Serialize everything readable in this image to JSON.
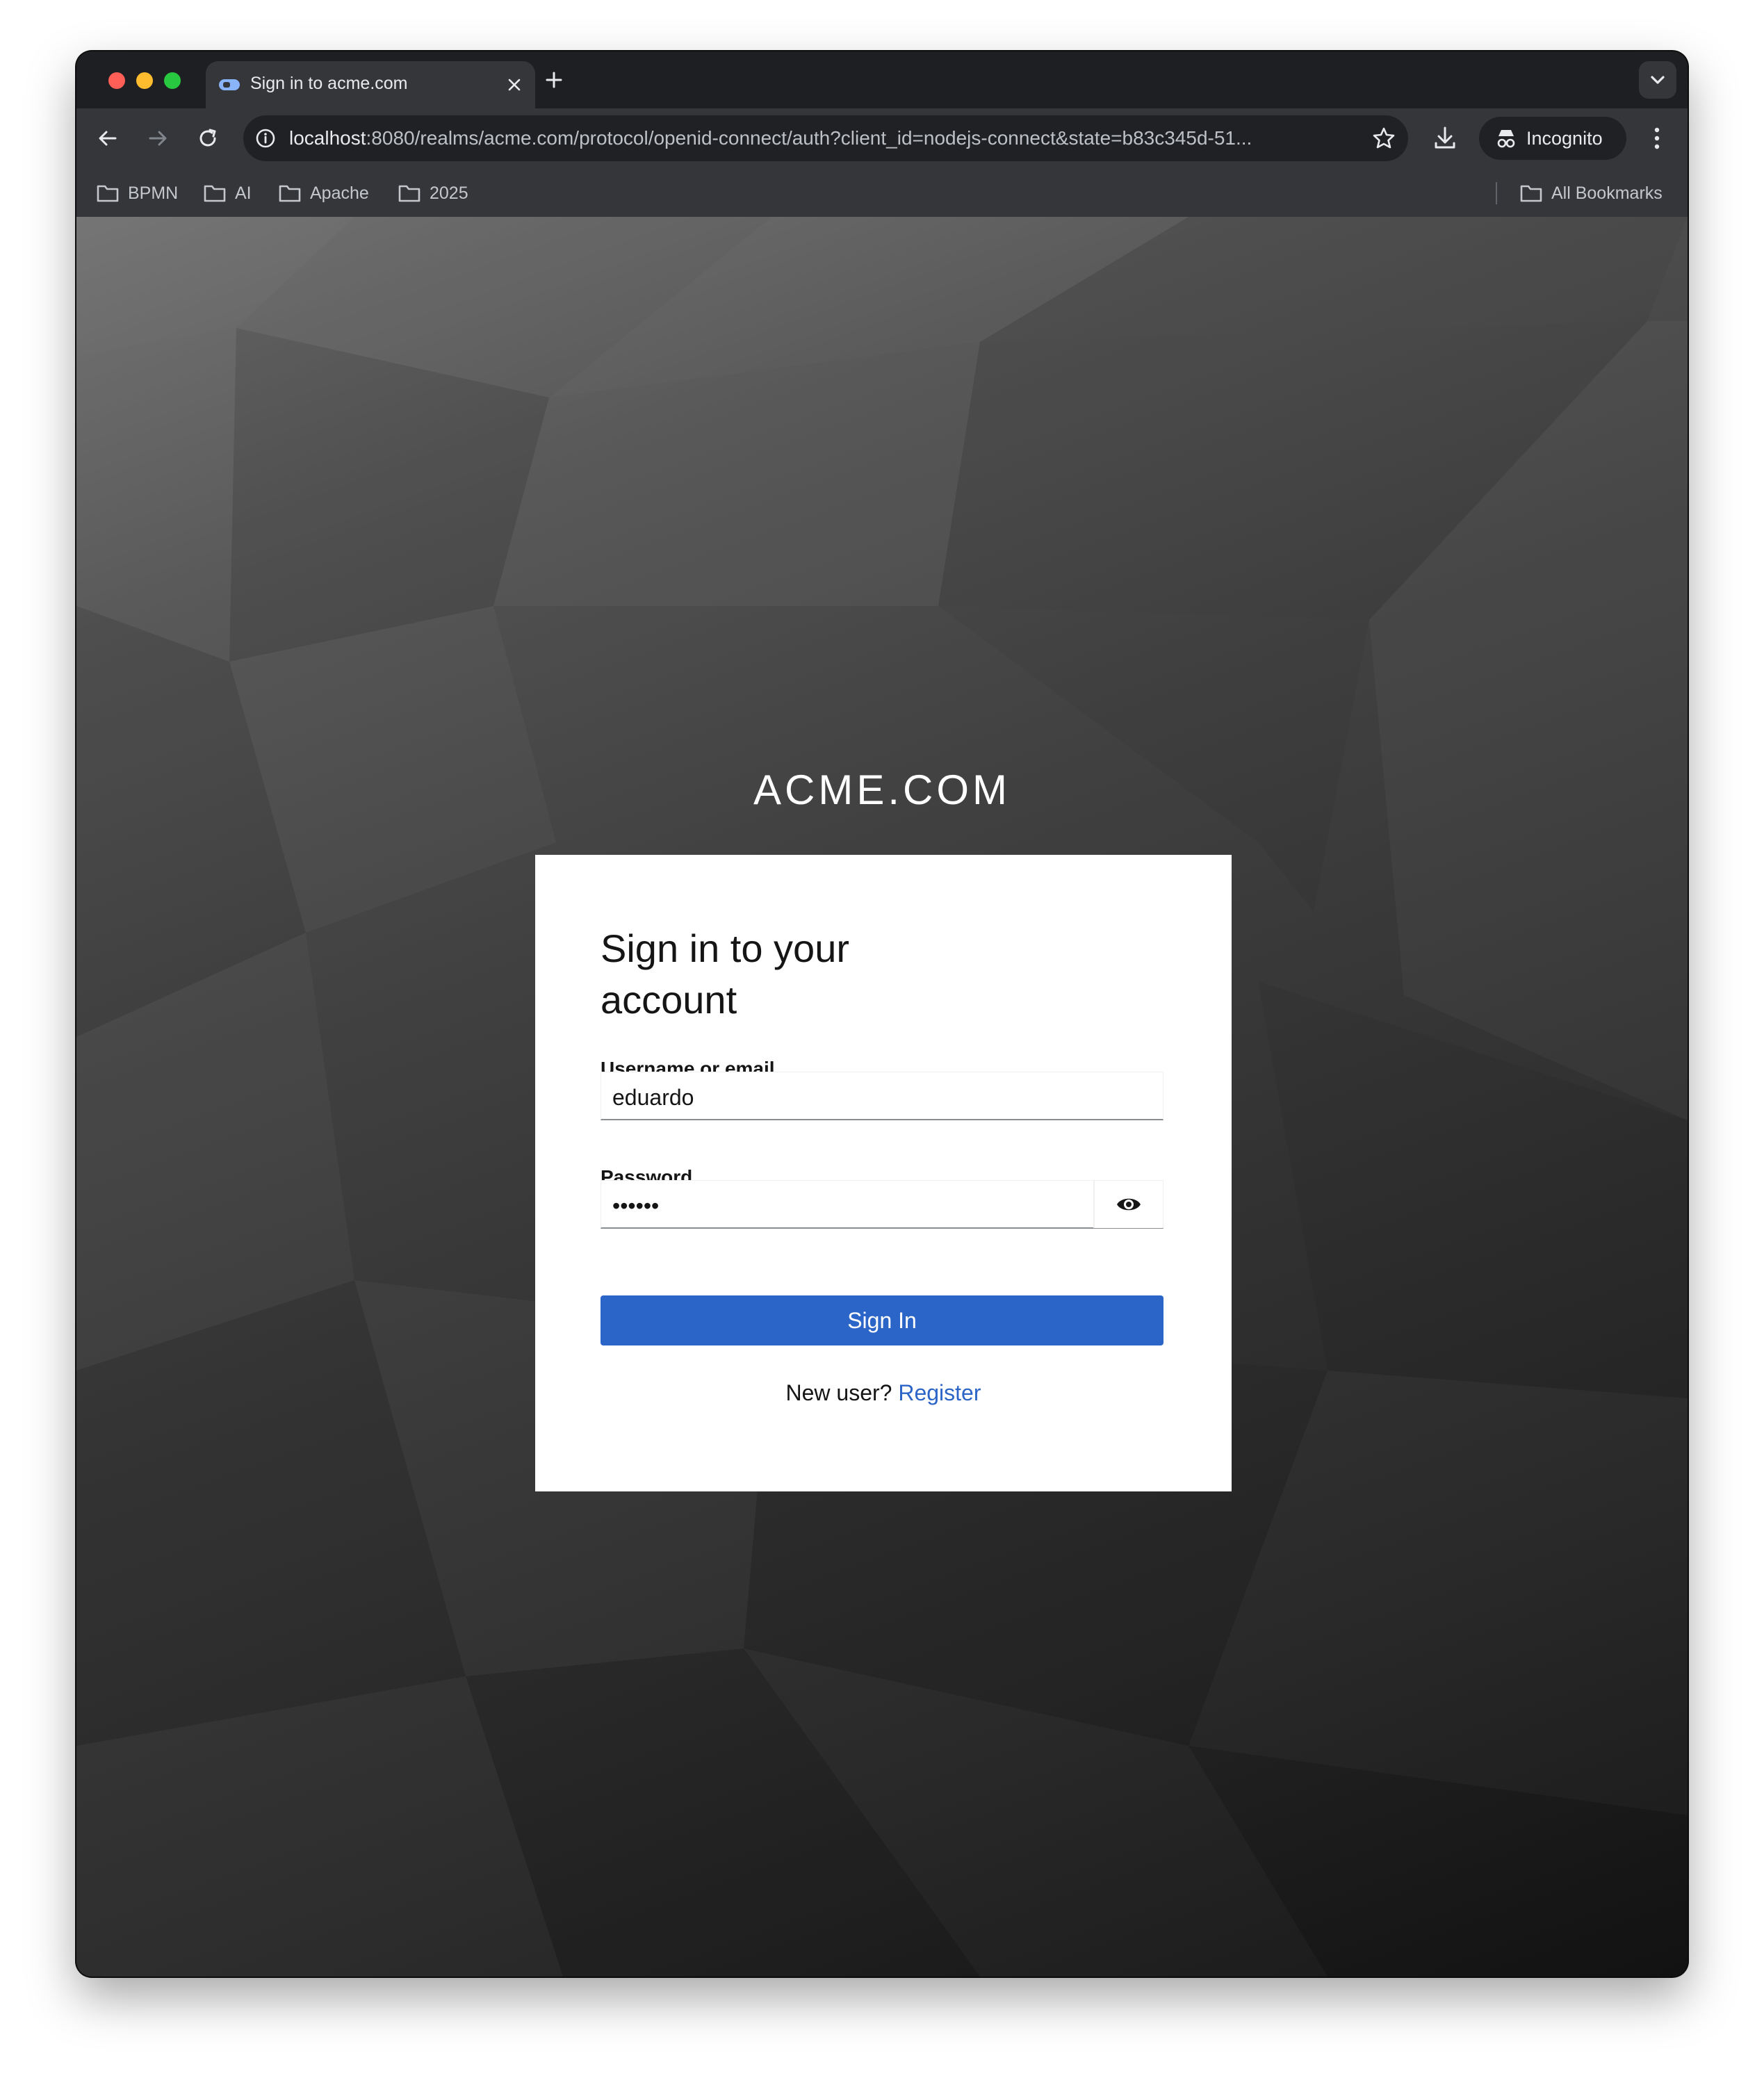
{
  "browser": {
    "tab": {
      "title": "Sign in to acme.com"
    },
    "omnibox": {
      "url_host": "localhost",
      "url_rest": ":8080/realms/acme.com/protocol/openid-connect/auth?client_id=nodejs-connect&state=b83c345d-51..."
    },
    "incognito_label": "Incognito",
    "bookmarks": [
      "BPMN",
      "AI",
      "Apache",
      "2025"
    ],
    "all_bookmarks_label": "All Bookmarks"
  },
  "page": {
    "brand": "ACME.COM",
    "form": {
      "title": "Sign in to your account",
      "username_label": "Username or email",
      "username_value": "eduardo",
      "password_label": "Password",
      "password_value": "••••••",
      "submit_label": "Sign In",
      "new_user_text": "New user?",
      "register_label": "Register"
    }
  },
  "colors": {
    "primary": "#2b65c8",
    "chrome_dark": "#35363a"
  }
}
